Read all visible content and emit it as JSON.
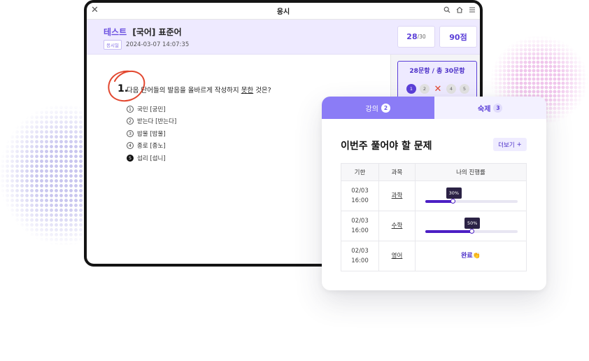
{
  "tablet": {
    "title": "응시",
    "close_icon": "close-icon",
    "top_icons": [
      "search-icon",
      "home-icon",
      "menu-icon"
    ],
    "subject_tag": "테스트",
    "subject_title": "[국어] 표준어",
    "date_badge": "응시일",
    "date": "2024-03-07 14:07:35",
    "score_count": "28",
    "score_count_total": "/30",
    "score_points": "90점",
    "question": {
      "number": "1.",
      "text_before": "다음 단어들의 발음을 올바르게 작성하지 ",
      "text_underlined": "못한",
      "text_after": " 것은?",
      "options": [
        {
          "num": "1",
          "text": "국민 [궁민]"
        },
        {
          "num": "2",
          "text": "받는다 [반는다]"
        },
        {
          "num": "3",
          "text": "밥물 [밤물]"
        },
        {
          "num": "4",
          "text": "종로 [종노]"
        },
        {
          "num": "5",
          "text": "섭리 [섭니]",
          "selected": true
        }
      ]
    },
    "progress": {
      "title": "28문항 / 총 30문항",
      "dots": [
        "1",
        "2",
        "✕",
        "4",
        "5"
      ]
    }
  },
  "card": {
    "tabs": [
      {
        "label": "강의",
        "count": "2"
      },
      {
        "label": "숙제",
        "count": "3"
      }
    ],
    "title": "이번주 풀어야 할 문제",
    "more_label": "더보기",
    "more_icon": "+",
    "table": {
      "headers": [
        "기한",
        "과목",
        "나의 진행률"
      ],
      "rows": [
        {
          "date_line1": "02/03",
          "date_line2": "16:00",
          "subject": "과학",
          "progress_label": "30%",
          "progress": 30
        },
        {
          "date_line1": "02/03",
          "date_line2": "16:00",
          "subject": "수학",
          "progress_label": "50%",
          "progress": 50
        },
        {
          "date_line1": "02/03",
          "date_line2": "16:00",
          "subject": "영어",
          "done_label": "완료👏"
        }
      ]
    }
  },
  "colors": {
    "accent": "#5b3fd8",
    "tab_active": "#8b7cf6",
    "header_bg": "#eeeaff",
    "mark_red": "#e2472f"
  }
}
